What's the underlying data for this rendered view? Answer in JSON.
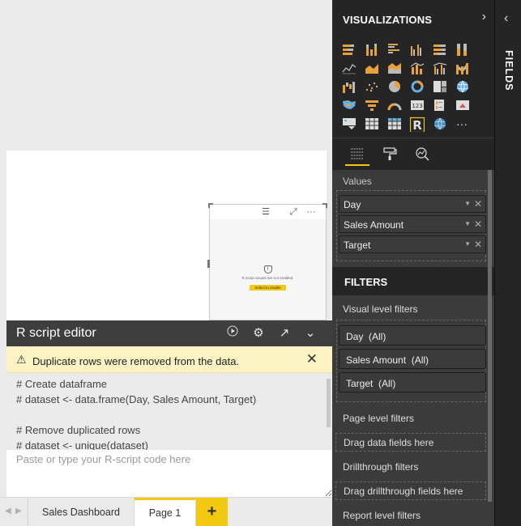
{
  "canvas": {
    "visual": {
      "placeholder_text": "R script visuals are not enabled.",
      "enable_label": "Select to enable"
    }
  },
  "r_editor": {
    "title": "R script editor",
    "warning": "Duplicate rows were removed from the data.",
    "code_lines": [
      "# Create dataframe",
      "# dataset <- data.frame(Day, Sales Amount, Target)",
      "",
      "# Remove duplicated rows",
      "# dataset <- unique(dataset)"
    ],
    "input_placeholder": "Paste or type your R-script code here"
  },
  "pages": {
    "tabs": [
      {
        "label": "Sales Dashboard",
        "active": false
      },
      {
        "label": "Page 1",
        "active": true
      }
    ],
    "add_label": "+"
  },
  "visualizations": {
    "title": "VISUALIZATIONS",
    "more_label": "···",
    "values_label": "Values",
    "fields": [
      {
        "label": "Day"
      },
      {
        "label": "Sales Amount"
      },
      {
        "label": "Target"
      }
    ]
  },
  "filters": {
    "title": "FILTERS",
    "visual_level": "Visual level filters",
    "visual_filters": [
      "Day  (All)",
      "Sales Amount  (All)",
      "Target  (All)"
    ],
    "page_level": "Page level filters",
    "page_drop": "Drag data fields here",
    "drillthrough": "Drillthrough filters",
    "drillthrough_drop": "Drag drillthrough fields here",
    "report_level": "Report level filters"
  },
  "fields_pane": {
    "label": "FIELDS"
  },
  "colors": {
    "accent": "#f2c811",
    "pane_dark": "#252525",
    "pane_mid": "#3b3b3b",
    "warning_bg": "#fbf3c3"
  }
}
